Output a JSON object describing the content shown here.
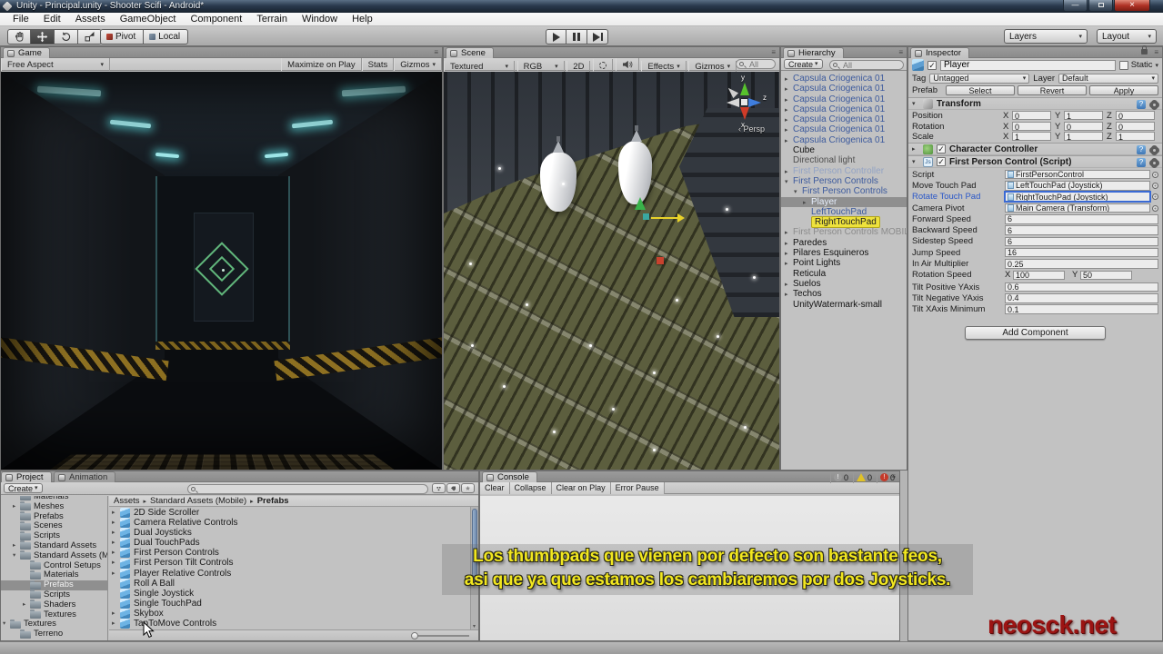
{
  "window": {
    "title": "Unity - Principal.unity - Shooter Scifi - Android*"
  },
  "icons": {
    "caret": "▾",
    "arrow_r": "▸",
    "arrow_d": "▾",
    "check": "✓",
    "crumb": "▸",
    "close": "×",
    "minimize": "—",
    "persp_arrow": "‹",
    "panel_menu": "≡",
    "help": "?",
    "js": "Js",
    "exclaim": "!",
    "up": "▴",
    "down": "▾"
  },
  "menu": {
    "items": [
      {
        "label": "File"
      },
      {
        "label": "Edit"
      },
      {
        "label": "Assets"
      },
      {
        "label": "GameObject"
      },
      {
        "label": "Component"
      },
      {
        "label": "Terrain"
      },
      {
        "label": "Window"
      },
      {
        "label": "Help"
      }
    ]
  },
  "toolbar": {
    "pivot": "Pivot",
    "local": "Local",
    "layers": "Layers",
    "layout": "Layout"
  },
  "game": {
    "tab": "Game",
    "aspect": "Free Aspect",
    "maximize_on_play": "Maximize on Play",
    "stats": "Stats",
    "gizmos": "Gizmos"
  },
  "scene": {
    "tab": "Scene",
    "shading": "Textured",
    "color_mode": "RGB",
    "mode_2d": "2D",
    "effects": "Effects",
    "gizmos": "Gizmos",
    "search_placeholder": "All",
    "persp_label": "Persp",
    "gizmo_axes": {
      "x": "x",
      "y": "y",
      "z": "z"
    }
  },
  "hierarchy": {
    "tab": "Hierarchy",
    "create_label": "Create",
    "search_placeholder": "All",
    "items": [
      {
        "label": "Capsula Criogenica 01",
        "cls": "pf",
        "arrow": "r"
      },
      {
        "label": "Capsula Criogenica 01",
        "cls": "pf",
        "arrow": "r"
      },
      {
        "label": "Capsula Criogenica 01",
        "cls": "pf",
        "arrow": "r"
      },
      {
        "label": "Capsula Criogenica 01",
        "cls": "pf",
        "arrow": "r"
      },
      {
        "label": "Capsula Criogenica 01",
        "cls": "pf",
        "arrow": "r"
      },
      {
        "label": "Capsula Criogenica 01",
        "cls": "pf",
        "arrow": "r"
      },
      {
        "label": "Capsula Criogenica 01",
        "cls": "pf",
        "arrow": "r"
      },
      {
        "label": "Cube"
      },
      {
        "label": "Directional light",
        "cls": "dim"
      },
      {
        "label": "First Person Controller",
        "cls": "pf dis",
        "arrow": "r"
      },
      {
        "label": "First Person Controls",
        "cls": "pf",
        "arrow": "d"
      },
      {
        "label": "First Person Controls",
        "cls": "pf",
        "arrow": "d",
        "indent": 1
      },
      {
        "label": "Player",
        "cls": "sel pf",
        "arrow": "r",
        "indent": 2
      },
      {
        "label": "LeftTouchPad",
        "cls": "pf",
        "indent": 2
      },
      {
        "label": "RightTouchPad",
        "cls": "ylw",
        "indent": 2
      },
      {
        "label": "First Person Controls MOBILE",
        "cls": "dis",
        "arrow": "r"
      },
      {
        "label": "Paredes",
        "arrow": "r"
      },
      {
        "label": "Pilares Esquineros",
        "arrow": "r"
      },
      {
        "label": "Point Lights",
        "arrow": "r"
      },
      {
        "label": "Reticula"
      },
      {
        "label": "Suelos",
        "arrow": "r"
      },
      {
        "label": "Techos",
        "arrow": "r"
      },
      {
        "label": "UnityWatermark-small"
      }
    ]
  },
  "inspector": {
    "tab": "Inspector",
    "header": {
      "name": "Player",
      "static_label": "Static"
    },
    "tag_row": {
      "tag_label": "Tag",
      "tag_value": "Untagged",
      "layer_label": "Layer",
      "layer_value": "Default"
    },
    "prefab_row": {
      "label": "Prefab",
      "select": "Select",
      "revert": "Revert",
      "apply": "Apply"
    },
    "axis": {
      "x": "X",
      "y": "Y",
      "z": "Z"
    },
    "transform": {
      "title": "Transform",
      "rows": [
        {
          "label": "Position",
          "x": "0",
          "y": "1",
          "z": "0"
        },
        {
          "label": "Rotation",
          "x": "0",
          "y": "0",
          "z": "0"
        },
        {
          "label": "Scale",
          "x": "1",
          "y": "1",
          "z": "1"
        }
      ]
    },
    "character_controller": {
      "title": "Character Controller"
    },
    "fps": {
      "title": "First Person Control (Script)",
      "fields": [
        {
          "label": "Script",
          "value": "FirstPersonControl",
          "cls": "obj"
        },
        {
          "label": "Move Touch Pad",
          "value": "LeftTouchPad (Joystick)",
          "cls": "obj"
        },
        {
          "label": "Rotate Touch Pad",
          "value": "RightTouchPad (Joystick)",
          "cls": "obj hl"
        },
        {
          "label": "Camera Pivot",
          "value": "Main Camera (Transform)",
          "cls": "obj"
        },
        {
          "label": "Forward Speed",
          "value": "6"
        },
        {
          "label": "Backward Speed",
          "value": "6"
        },
        {
          "label": "Sidestep Speed",
          "value": "6"
        },
        {
          "label": "Jump Speed",
          "value": "16"
        },
        {
          "label": "In Air Multiplier",
          "value": "0.25"
        }
      ],
      "rotation_speed": {
        "label": "Rotation Speed",
        "x_label": "X",
        "x": "100",
        "y_label": "Y",
        "y": "50"
      },
      "fields2": [
        {
          "label": "Tilt Positive YAxis",
          "value": "0.6"
        },
        {
          "label": "Tilt Negative YAxis",
          "value": "0.4"
        },
        {
          "label": "Tilt XAxis Minimum",
          "value": "0.1"
        }
      ]
    },
    "add_component": "Add Component"
  },
  "project": {
    "tab": "Project",
    "animation_tab": "Animation",
    "create_label": "Create",
    "tree": [
      {
        "label": "Materials",
        "indent": 1,
        "cls": "cut"
      },
      {
        "label": "Meshes",
        "indent": 1,
        "arrow": "r"
      },
      {
        "label": "Prefabs",
        "indent": 1
      },
      {
        "label": "Scenes",
        "indent": 1
      },
      {
        "label": "Scripts",
        "indent": 1
      },
      {
        "label": "Standard Assets",
        "indent": 1,
        "arrow": "r"
      },
      {
        "label": "Standard Assets (Mobile",
        "indent": 1,
        "arrow": "d"
      },
      {
        "label": "Control Setups",
        "indent": 2
      },
      {
        "label": "Materials",
        "indent": 2
      },
      {
        "label": "Prefabs",
        "indent": 2,
        "cls": "sel"
      },
      {
        "label": "Scripts",
        "indent": 2
      },
      {
        "label": "Shaders",
        "indent": 2,
        "arrow": "r"
      },
      {
        "label": "Textures",
        "indent": 2
      },
      {
        "label": "Textures",
        "indent": 0,
        "arrow": "d"
      },
      {
        "label": "Terreno",
        "indent": 1
      }
    ],
    "breadcrumb": {
      "root": "Assets",
      "mid": "Standard Assets (Mobile)",
      "leaf": "Prefabs"
    },
    "files": [
      {
        "label": "2D Side Scroller",
        "arrow": "r"
      },
      {
        "label": "Camera Relative Controls",
        "arrow": "r"
      },
      {
        "label": "Dual Joysticks",
        "arrow": "r"
      },
      {
        "label": "Dual TouchPads",
        "arrow": "r"
      },
      {
        "label": "First Person Controls",
        "arrow": "r"
      },
      {
        "label": "First Person Tilt Controls",
        "arrow": "r"
      },
      {
        "label": "Player Relative Controls",
        "arrow": "r"
      },
      {
        "label": "Roll A Ball"
      },
      {
        "label": "Single Joystick"
      },
      {
        "label": "Single TouchPad"
      },
      {
        "label": "Skybox",
        "arrow": "r"
      },
      {
        "label": "TapToMove Controls",
        "arrow": "r"
      }
    ]
  },
  "console": {
    "tab": "Console",
    "buttons": [
      {
        "label": "Clear"
      },
      {
        "label": "Collapse"
      },
      {
        "label": "Clear on Play"
      },
      {
        "label": "Error Pause"
      }
    ],
    "counts": {
      "info": "0",
      "warning": "0",
      "error": "0"
    }
  },
  "subtitle": {
    "line1": "Los thumbpads que vienen por defecto son bastante feos,",
    "line2": "asi que ya que estamos los cambiaremos por dos Joysticks."
  },
  "watermark": {
    "text": "neosck.net",
    "color": "#9c1413"
  }
}
